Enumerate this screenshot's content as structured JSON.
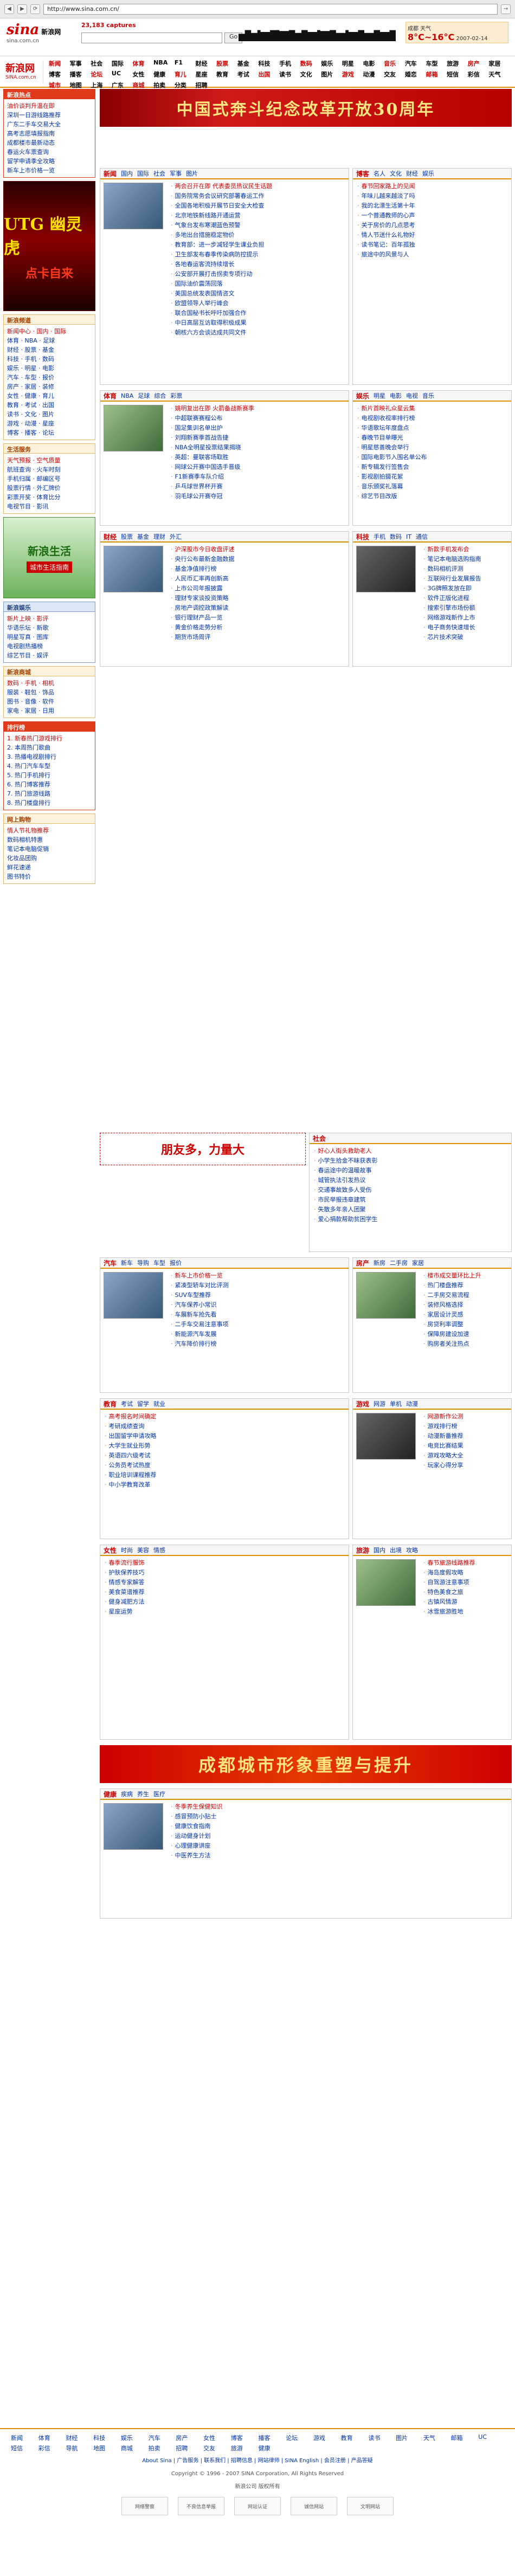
{
  "browser": {
    "url": "http://www.sina.com.cn/"
  },
  "header": {
    "logo": "sina",
    "logo_cn": "新浪网",
    "logo_sub": "sina.com.cn",
    "user_count_label": "23,183 captures",
    "search_placeholder": "",
    "search_btn": "Go",
    "weather_title": "成都 天气",
    "weather_temp": "8°C~16°C",
    "weather_date": "2007-02-14",
    "tagline": "新浪首页"
  },
  "nav": {
    "brand_cn": "新浪网",
    "brand_en": "SINA.com.cn",
    "items": [
      "新闻",
      "军事",
      "社会",
      "国际",
      "体育",
      "NBA",
      "F1",
      "财经",
      "股票",
      "基金",
      "科技",
      "手机",
      "数码",
      "娱乐",
      "明星",
      "电影",
      "音乐",
      "汽车",
      "车型",
      "旅游",
      "房产",
      "家居",
      "博客",
      "播客",
      "论坛",
      "UC",
      "女性",
      "健康",
      "育儿",
      "星座",
      "教育",
      "考试",
      "出国",
      "读书",
      "文化",
      "图片",
      "游戏",
      "动漫",
      "交友",
      "婚恋",
      "邮箱",
      "短信",
      "彩信",
      "天气",
      "城市",
      "地图",
      "上海",
      "广东",
      "商城",
      "拍卖",
      "分类",
      "招聘"
    ]
  },
  "left": {
    "topnews": {
      "title": "新浪热点",
      "items": [
        "油价谈判升温在即",
        "深圳一日游线路推荐",
        "广东二手车交易大全",
        "高考志愿填报指南",
        "成都楼市最新动态",
        "春运火车票查询",
        "留学申请季全攻略",
        "新车上市价格一览"
      ]
    },
    "ad1_title": "UTG 幽灵虎",
    "ad1_sub": "点卡自来",
    "channels": {
      "title": "新浪频道",
      "items": [
        "新闻中心 · 国内 · 国际",
        "体育 · NBA · 足球",
        "财经 · 股票 · 基金",
        "科技 · 手机 · 数码",
        "娱乐 · 明星 · 电影",
        "汽车 · 车型 · 报价",
        "房产 · 家居 · 装修",
        "女性 · 健康 · 育儿",
        "教育 · 考试 · 出国",
        "读书 · 文化 · 图片",
        "游戏 · 动漫 · 星座",
        "博客 · 播客 · 论坛"
      ]
    },
    "ad2_title": "新浪生活",
    "ad2_sub": "城市生活指南",
    "life": {
      "title": "生活服务",
      "items": [
        "天气预报 · 空气质量",
        "航班查询 · 火车时刻",
        "手机归属 · 邮编区号",
        "股票行情 · 外汇牌价",
        "彩票开奖 · 体育比分",
        "电视节目 · 影讯"
      ]
    },
    "ent": {
      "title": "新浪娱乐",
      "items": [
        "新片上映 · 影评",
        "华语乐坛 · 新歌",
        "明星写真 · 图库",
        "电视剧热播榜",
        "综艺节目 · 娱评"
      ]
    },
    "mall": {
      "title": "新浪商城",
      "items": [
        "数码 · 手机 · 相机",
        "服装 · 鞋包 · 饰品",
        "图书 · 音像 · 软件",
        "家电 · 家居 · 日用"
      ]
    },
    "ranking": {
      "title": "排行榜",
      "items": [
        "1. 新春热门游戏排行",
        "2. 本周热门歌曲",
        "3. 热播电视剧排行",
        "4. 热门汽车车型",
        "5. 热门手机排行",
        "6. 热门博客推荐",
        "7. 热门旅游线路",
        "8. 热门楼盘排行"
      ]
    },
    "market": {
      "title": "网上购物",
      "items": [
        "情人节礼物推荐",
        "数码相机特惠",
        "笔记本电脑促销",
        "化妆品团购",
        "鲜花速递",
        "图书特价"
      ]
    }
  },
  "ad_banner": "中国式奔斗纪念改革开放30周年",
  "sections": {
    "news": {
      "title": "新闻",
      "tabs": [
        "国内",
        "国际",
        "社会",
        "军事",
        "图片"
      ],
      "items": [
        "两会召开在即 代表委员热议民生话题",
        "国务院常务会议研究部署春运工作",
        "全国各地积极开展节日安全大检查",
        "北京地铁新线路开通运营",
        "气象台发布寒潮蓝色预警",
        "多地出台措施稳定物价",
        "教育部：进一步减轻学生课业负担",
        "卫生部发布春季传染病防控提示",
        "各地春运客流持续增长",
        "公安部开展打击拐卖专项行动",
        "国际油价震荡回落",
        "美国总统发表国情咨文",
        "欧盟领导人举行峰会",
        "联合国秘书长呼吁加强合作",
        "中日高层互访取得积极成果",
        "朝核六方会谈达成共同文件"
      ]
    },
    "blog": {
      "title": "博客",
      "tabs": [
        "名人",
        "文化",
        "财经",
        "娱乐"
      ],
      "items": [
        "春节回家路上的见闻",
        "年味儿越来越淡了吗",
        "我的北漂生活第十年",
        "一个普通教师的心声",
        "关于房价的几点思考",
        "情人节送什么礼物好",
        "读书笔记：百年孤独",
        "旅途中的风景与人"
      ]
    },
    "sports": {
      "title": "体育",
      "tabs": [
        "NBA",
        "足球",
        "综合",
        "彩票"
      ],
      "items": [
        "姚明复出在即 火箭备战新赛季",
        "中超联赛赛程公布",
        "国足集训名单出炉",
        "刘翔新赛季首战告捷",
        "NBA全明星投票结果揭晓",
        "英超：曼联客场取胜",
        "网球公开赛中国选手晋级",
        "F1新赛季车队介绍",
        "乒乓球世界杯开赛",
        "羽毛球公开赛夺冠"
      ]
    },
    "ent": {
      "title": "娱乐",
      "tabs": [
        "明星",
        "电影",
        "电视",
        "音乐"
      ],
      "items": [
        "新片首映礼众星云集",
        "电视剧收视率排行榜",
        "华语歌坛年度盘点",
        "春晚节目单曝光",
        "明星慈善晚会举行",
        "国际电影节入围名单公布",
        "新专辑发行签售会",
        "影视剧拍摄花絮",
        "音乐颁奖礼落幕",
        "综艺节目改版"
      ]
    },
    "finance": {
      "title": "财经",
      "tabs": [
        "股票",
        "基金",
        "理财",
        "外汇"
      ],
      "items": [
        "沪深股市今日收盘评述",
        "央行公布最新金融数据",
        "基金净值排行榜",
        "人民币汇率再创新高",
        "上市公司年报披露",
        "理财专家谈投资策略",
        "房地产调控政策解读",
        "银行理财产品一览",
        "黄金价格走势分析",
        "期货市场周评"
      ]
    },
    "tech": {
      "title": "科技",
      "tabs": [
        "手机",
        "数码",
        "IT",
        "通信"
      ],
      "items": [
        "新款手机发布会",
        "笔记本电脑选购指南",
        "数码相机评测",
        "互联网行业发展报告",
        "3G牌照发放在即",
        "软件正版化进程",
        "搜索引擎市场份额",
        "网络游戏新作上市",
        "电子商务快速增长",
        "芯片技术突破"
      ]
    },
    "society": {
      "title": "社会",
      "items": [
        "好心人街头救助老人",
        "小学生拾金不昧获表彰",
        "春运途中的温暖故事",
        "城管执法引发热议",
        "交通事故致多人受伤",
        "市民举报违章建筑",
        "失散多年亲人团聚",
        "爱心捐款帮助贫困学生"
      ]
    },
    "auto": {
      "title": "汽车",
      "tabs": [
        "新车",
        "导购",
        "车型",
        "报价"
      ],
      "items": [
        "新车上市价格一览",
        "紧凑型轿车对比评测",
        "SUV车型推荐",
        "汽车保养小常识",
        "车展新车抢先看",
        "二手车交易注意事项",
        "新能源汽车发展",
        "汽车降价排行榜"
      ]
    },
    "house": {
      "title": "房产",
      "tabs": [
        "新房",
        "二手房",
        "家居"
      ],
      "items": [
        "楼市成交量环比上升",
        "热门楼盘推荐",
        "二手房交易流程",
        "装修风格选择",
        "家居设计灵感",
        "房贷利率调整",
        "保障房建设加速",
        "购房者关注热点"
      ]
    },
    "edu": {
      "title": "教育",
      "tabs": [
        "考试",
        "留学",
        "就业"
      ],
      "items": [
        "高考报名时间确定",
        "考研成绩查询",
        "出国留学申请攻略",
        "大学生就业形势",
        "英语四六级考试",
        "公务员考试热度",
        "职业培训课程推荐",
        "中小学教育改革"
      ]
    },
    "games": {
      "title": "游戏",
      "tabs": [
        "网游",
        "单机",
        "动漫"
      ],
      "items": [
        "网游新作公测",
        "游戏排行榜",
        "动漫新番推荐",
        "电竞比赛结果",
        "游戏攻略大全",
        "玩家心得分享"
      ]
    },
    "female": {
      "title": "女性",
      "tabs": [
        "时尚",
        "美容",
        "情感"
      ],
      "items": [
        "春季流行服饰",
        "护肤保养技巧",
        "情感专家解答",
        "美食菜谱推荐",
        "健身减肥方法",
        "星座运势"
      ]
    },
    "travel": {
      "title": "旅游",
      "tabs": [
        "国内",
        "出境",
        "攻略"
      ],
      "items": [
        "春节旅游线路推荐",
        "海岛度假攻略",
        "自驾游注意事项",
        "特色美食之旅",
        "古镇风情游",
        "冰雪旅游胜地"
      ]
    },
    "health": {
      "title": "健康",
      "tabs": [
        "疾病",
        "养生",
        "医疗"
      ],
      "items": [
        "冬季养生保健知识",
        "感冒预防小贴士",
        "健康饮食指南",
        "运动健身计划",
        "心理健康讲座",
        "中医养生方法"
      ]
    }
  },
  "banner2": "成都城市形象重塑与提升",
  "banner3": "朋友多，力量大",
  "footer": {
    "links": [
      "新闻",
      "体育",
      "财经",
      "科技",
      "娱乐",
      "汽车",
      "房产",
      "女性",
      "博客",
      "播客",
      "论坛",
      "游戏",
      "教育",
      "读书",
      "图片",
      "天气",
      "邮箱",
      "UC",
      "短信",
      "彩信",
      "导航",
      "地图",
      "商城",
      "拍卖",
      "招聘",
      "交友",
      "旅游",
      "健康"
    ],
    "about": "About Sina | 广告服务 | 联系我们 | 招聘信息 | 网站律师 | SINA English | 会员注册 | 产品答疑",
    "copyright": "Copyright © 1996 - 2007 SINA Corporation, All Rights Reserved",
    "icp": "新浪公司 版权所有",
    "badges": [
      "网络警察",
      "不良信息举报",
      "网站认证",
      "诚信网站",
      "文明网站"
    ]
  }
}
